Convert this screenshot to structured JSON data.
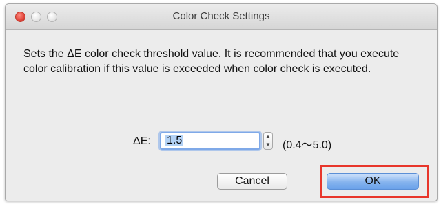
{
  "window": {
    "title": "Color Check Settings"
  },
  "message": "Sets the ΔE color check threshold value. It is recommended that you execute color calibration if this value is exceeded when color check is executed.",
  "threshold": {
    "label": "ΔE:",
    "value": "1.5",
    "range": "(0.4～5.0)"
  },
  "buttons": {
    "cancel": "Cancel",
    "ok": "OK"
  },
  "colors": {
    "highlight": "#e8362b",
    "default_button": "#86b4ee",
    "focus_ring": "#7fa9e8"
  },
  "icons": {
    "stepper_up": "▲",
    "stepper_down": "▼"
  }
}
